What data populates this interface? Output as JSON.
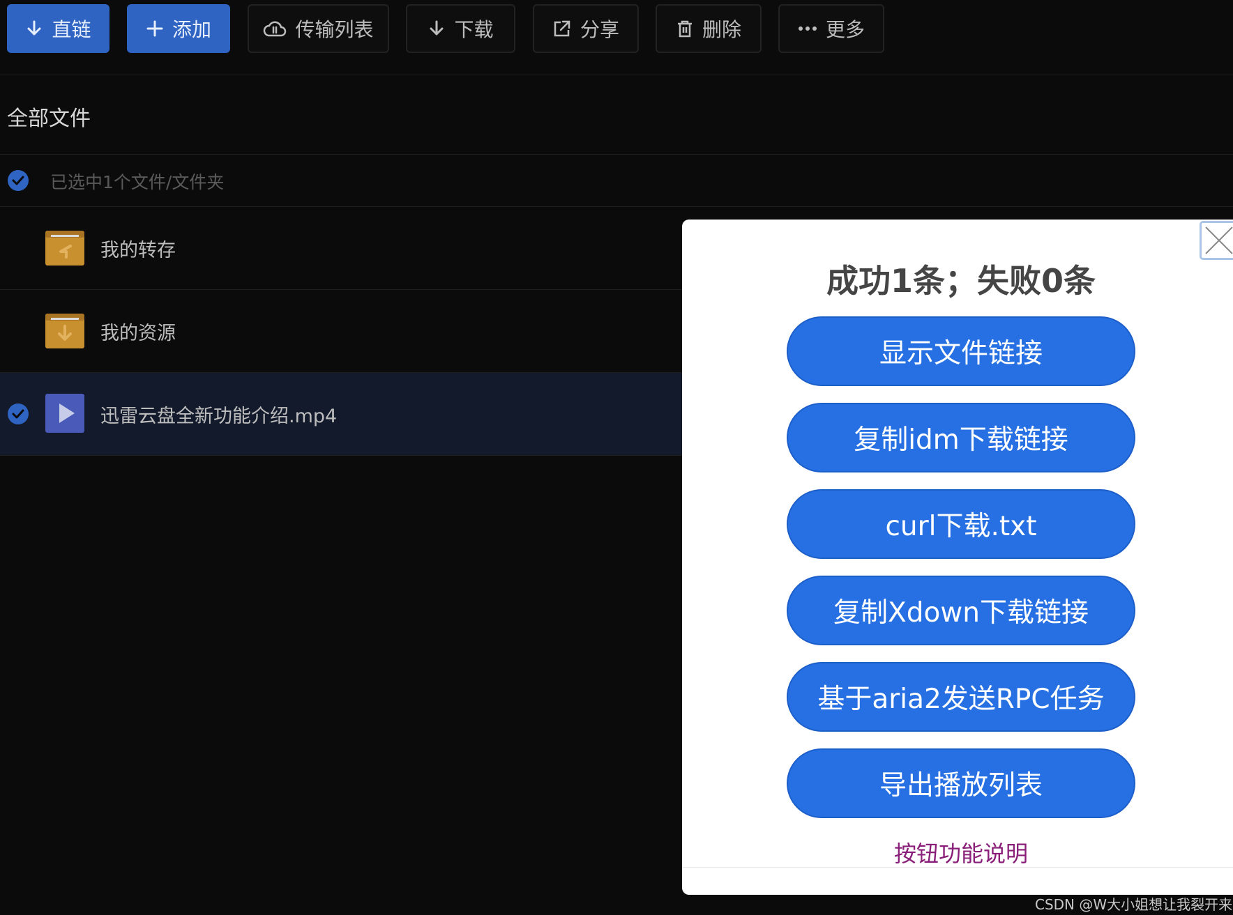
{
  "toolbar": {
    "buttons": [
      {
        "label": "直链",
        "icon": "arrow-down-icon",
        "primary": true
      },
      {
        "label": "添加",
        "icon": "plus-icon",
        "primary": true
      },
      {
        "label": "传输列表",
        "icon": "cloud-transfer-icon",
        "primary": false
      },
      {
        "label": "下载",
        "icon": "arrow-down-icon",
        "primary": false
      },
      {
        "label": "分享",
        "icon": "share-icon",
        "primary": false
      },
      {
        "label": "删除",
        "icon": "trash-icon",
        "primary": false
      },
      {
        "label": "更多",
        "icon": "more-dots-icon",
        "primary": false
      }
    ]
  },
  "breadcrumb": "全部文件",
  "selection": {
    "text": "已选中1个文件/文件夹"
  },
  "files": [
    {
      "name": "我的转存",
      "type": "folder",
      "icon": "folder-transfer-icon",
      "selected": false
    },
    {
      "name": "我的资源",
      "type": "folder",
      "icon": "folder-download-icon",
      "selected": false
    },
    {
      "name": "迅雷云盘全新功能介绍.mp4",
      "type": "video",
      "icon": "video-play-icon",
      "selected": true
    }
  ],
  "modal": {
    "title": "成功1条；失败0条",
    "buttons": [
      "显示文件链接",
      "复制idm下载链接",
      "curl下载.txt",
      "复制Xdown下载链接",
      "基于aria2发送RPC任务",
      "导出播放列表"
    ],
    "help_link": "按钮功能说明"
  },
  "watermark": "CSDN @W大小姐想让我裂开来",
  "colors": {
    "primary": "#2f64c2",
    "modal_button": "#2670e4",
    "folder": "#c8902e",
    "link": "#8a1f7a"
  }
}
